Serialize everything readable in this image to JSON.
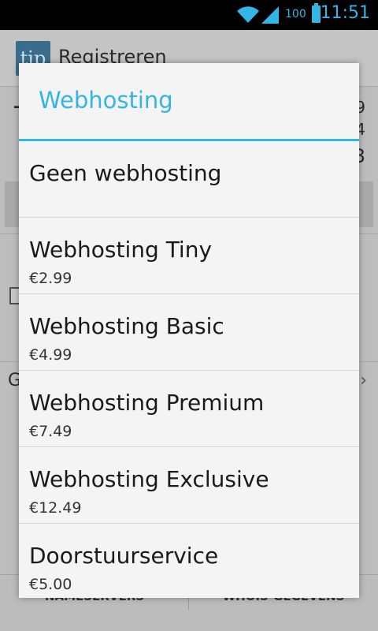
{
  "status_bar": {
    "battery_percent": "100",
    "time": "11:51"
  },
  "background": {
    "app_title": "Registreren",
    "logo_text": "tip",
    "letter": "T",
    "num_1": "9",
    "num_2": "4",
    "num_3": "3",
    "row_letter": "G",
    "tab_left": "NAMESERVERS",
    "tab_right": "WHOIS-GEGEVENS"
  },
  "dialog": {
    "title": "Webhosting",
    "options": [
      {
        "name": "Geen webhosting",
        "price": ""
      },
      {
        "name": "Webhosting Tiny",
        "price": "€2.99"
      },
      {
        "name": "Webhosting Basic",
        "price": "€4.99"
      },
      {
        "name": "Webhosting Premium",
        "price": "€7.49"
      },
      {
        "name": "Webhosting Exclusive",
        "price": "€12.49"
      },
      {
        "name": "Doorstuurservice",
        "price": "€5.00"
      }
    ]
  },
  "colors": {
    "accent": "#33b5e5",
    "dialog_bg": "#f4f4f4",
    "text": "#1a1a1a"
  }
}
